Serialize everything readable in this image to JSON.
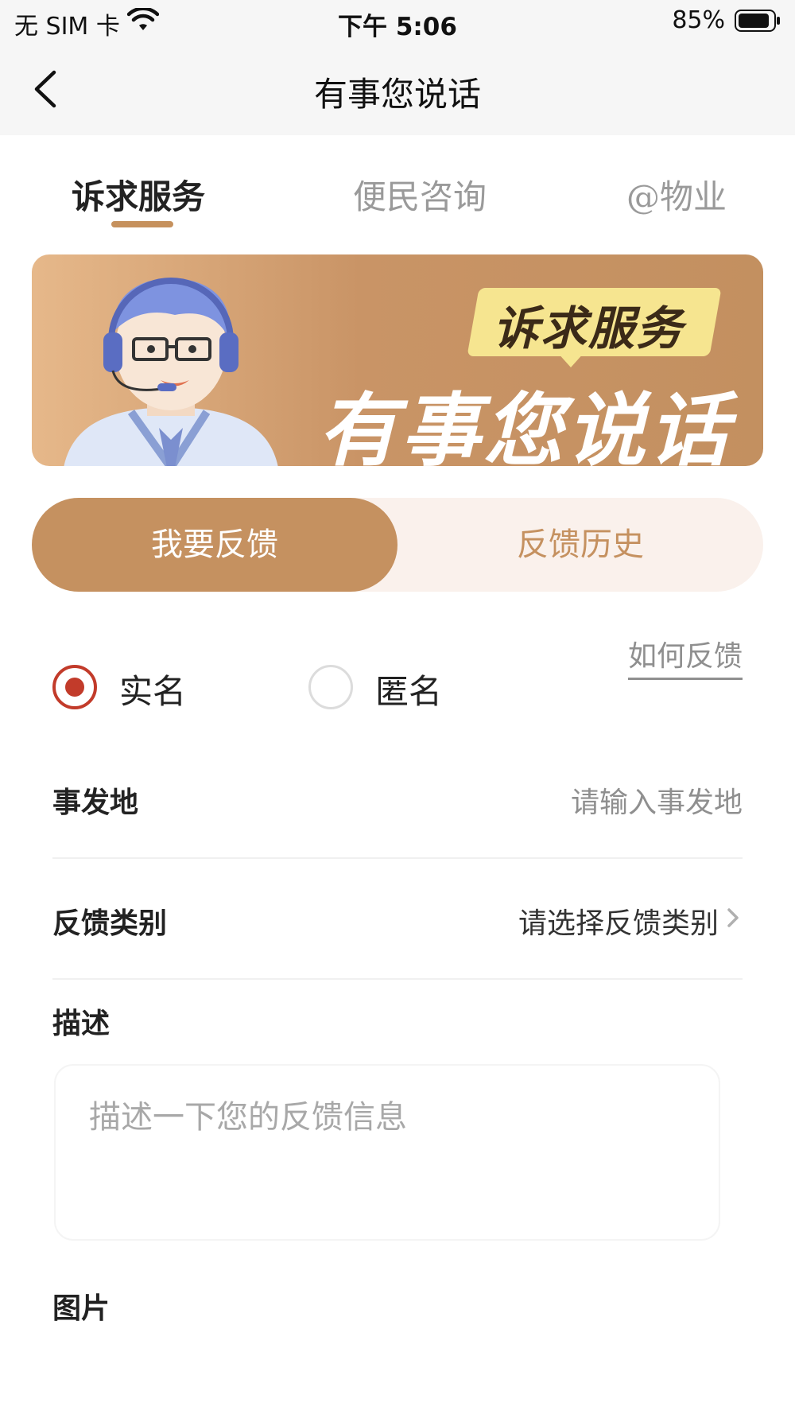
{
  "status_bar": {
    "carrier": "无 SIM 卡",
    "time": "下午 5:06",
    "battery_percent": "85%"
  },
  "nav": {
    "title": "有事您说话"
  },
  "tabs": [
    {
      "label": "诉求服务",
      "active": true
    },
    {
      "label": "便民咨询",
      "active": false
    },
    {
      "label": "@物业",
      "active": false
    }
  ],
  "banner": {
    "tag": "诉求服务",
    "headline": "有事您说话"
  },
  "segment": {
    "active": "我要反馈",
    "inactive": "反馈历史"
  },
  "form": {
    "how_to_link": "如何反馈",
    "identity_options": [
      {
        "label": "实名",
        "checked": true
      },
      {
        "label": "匿名",
        "checked": false
      }
    ],
    "location_label": "事发地",
    "location_placeholder": "请输入事发地",
    "category_label": "反馈类别",
    "category_value": "请选择反馈类别",
    "description_label": "描述",
    "description_placeholder": "描述一下您的反馈信息",
    "images_label": "图片"
  },
  "colors": {
    "accent": "#c59160",
    "radio_active": "#c23b2a",
    "banner_tag": "#f6e590"
  }
}
